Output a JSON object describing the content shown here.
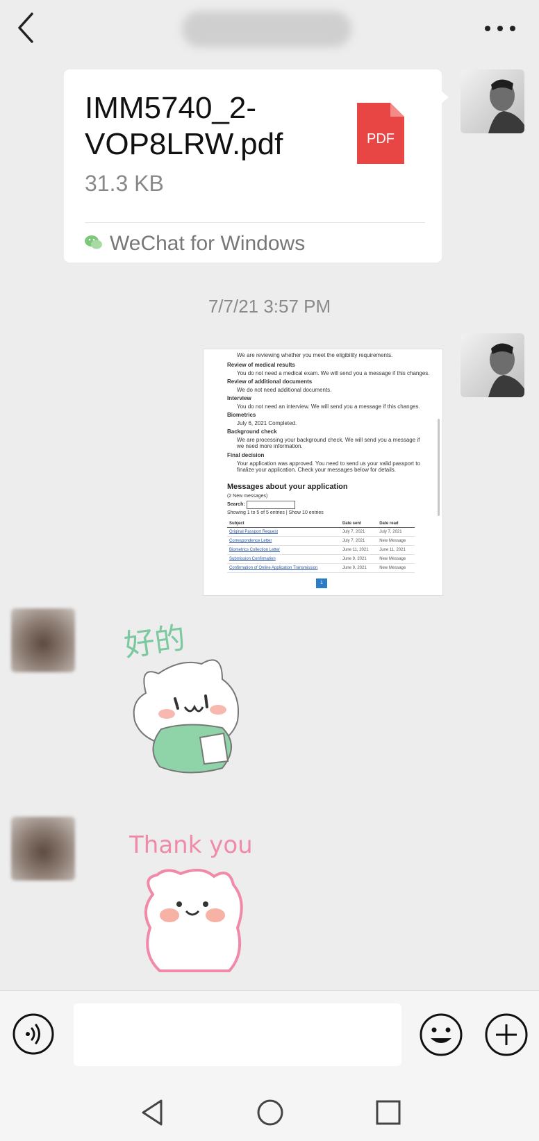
{
  "header": {
    "back_icon": "back-chevron-icon",
    "more_icon": "more-dots-icon"
  },
  "file_message": {
    "file_name": "IMM5740_2-VOP8LRW.pdf",
    "file_size": "31.3 KB",
    "file_type_label": "PDF",
    "source": "WeChat for Windows",
    "pdf_color": "#e84545"
  },
  "timestamp": "7/7/21 3:57 PM",
  "doc_screenshot": {
    "lines": [
      "We are reviewing whether you meet the eligibility requirements.",
      "Review of medical results",
      "You do not need a medical exam. We will send you a message if this changes.",
      "Review of additional documents",
      "We do not need additional documents.",
      "Interview",
      "You do not need an interview. We will send you a message if this changes.",
      "Biometrics",
      "July 6, 2021 Completed.",
      "Background check",
      "We are processing your background check. We will send you a message if we need more information.",
      "Final decision",
      "Your application was approved. You need to send us your valid passport to finalize your application. Check your messages below for details."
    ],
    "heading": "Messages about your application",
    "new_messages": "(2 New messages)",
    "search_label": "Search:",
    "showing": "Showing 1 to 5 of 5 entries | Show 10 entries",
    "columns": [
      "Subject",
      "Date sent",
      "Date read"
    ],
    "rows": [
      [
        "Original Passport Request",
        "July 7, 2021",
        "July 7, 2021"
      ],
      [
        "Correspondence Letter",
        "July 7, 2021",
        "New Message"
      ],
      [
        "Biometrics Collection Letter",
        "June 11, 2021",
        "June 11, 2021"
      ],
      [
        "Submission Confirmation",
        "June 9, 2021",
        "New Message"
      ],
      [
        "Confirmation of Online Application Transmission",
        "June 9, 2021",
        "New Message"
      ]
    ],
    "page": "1"
  },
  "stickers": [
    {
      "text": "好的",
      "color": "#7cc8a0"
    },
    {
      "text": "Thank you",
      "color": "#f08aa8"
    }
  ],
  "input_bar": {
    "voice_icon": "voice-icon",
    "emoji_icon": "emoji-icon",
    "plus_icon": "plus-icon"
  },
  "nav": {
    "back_icon": "nav-back-icon",
    "home_icon": "nav-home-icon",
    "recent_icon": "nav-recent-icon"
  }
}
